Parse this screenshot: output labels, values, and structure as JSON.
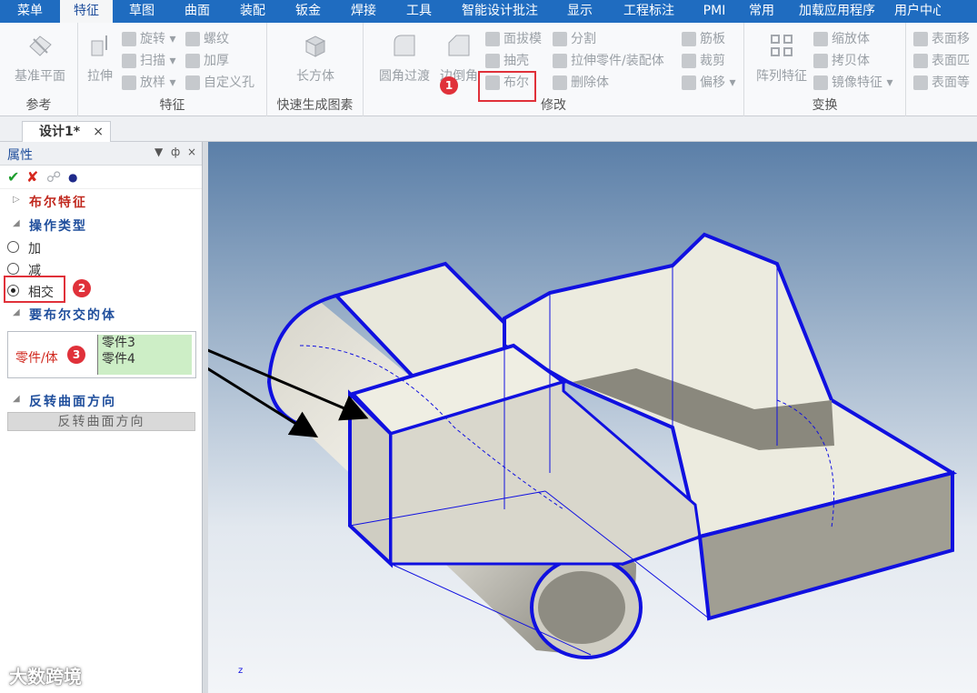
{
  "menubar": {
    "items": [
      "菜单",
      "特征",
      "草图",
      "曲面",
      "装配",
      "钣金",
      "焊接",
      "工具",
      "智能设计批注",
      "显示",
      "工程标注",
      "PMI",
      "常用",
      "加载应用程序",
      "用户中心"
    ],
    "active_index": 1
  },
  "ribbon": {
    "groups": {
      "reference": {
        "title": "参考",
        "datum_plane": "基准平面"
      },
      "feature": {
        "title": "特征",
        "extrude": "拉伸",
        "revolve": "旋转",
        "sweep": "扫描",
        "loft": "放样",
        "thread": "螺纹",
        "thicken": "加厚",
        "custom_hole": "自定义孔"
      },
      "quick": {
        "title": "快速生成图素",
        "box": "长方体"
      },
      "modify": {
        "title": "修改",
        "round": "圆角过渡",
        "chamfer": "边倒角",
        "draft": "面拔模",
        "shell": "抽壳",
        "boolean": "布尔",
        "split": "分割",
        "extrude_part": "拉伸零件/装配体",
        "delete_body": "删除体",
        "rib": "筋板",
        "trim": "裁剪",
        "offset": "偏移"
      },
      "transform": {
        "title": "变换",
        "pattern": "阵列特征",
        "scale": "缩放体",
        "copy": "拷贝体",
        "mirror": "镜像特征"
      },
      "face": {
        "move": "表面移",
        "match": "表面匹",
        "equal": "表面等"
      }
    }
  },
  "doc_tab": {
    "label": "设计1*",
    "close": "×"
  },
  "panel": {
    "title": "属性",
    "controls": {
      "dropdown": "▼",
      "pin": "ф",
      "close": "×"
    },
    "section_boolean": "布尔特征",
    "section_op": "操作类型",
    "options": [
      "加",
      "减",
      "相交"
    ],
    "selected_option": "相交",
    "section_bodies": "要布尔交的体",
    "bodies_label": "零件/体",
    "bodies": [
      "零件3",
      "零件4"
    ],
    "section_flip": "反转曲面方向",
    "flip_button": "反转曲面方向"
  },
  "annotations": {
    "step1": "1",
    "step2": "2",
    "step3": "3"
  },
  "watermark": "大数跨境",
  "axis_label": "z",
  "colors": {
    "menubar": "#1f6cc0",
    "edge": "#1010e0",
    "marker": "#e0313a"
  }
}
